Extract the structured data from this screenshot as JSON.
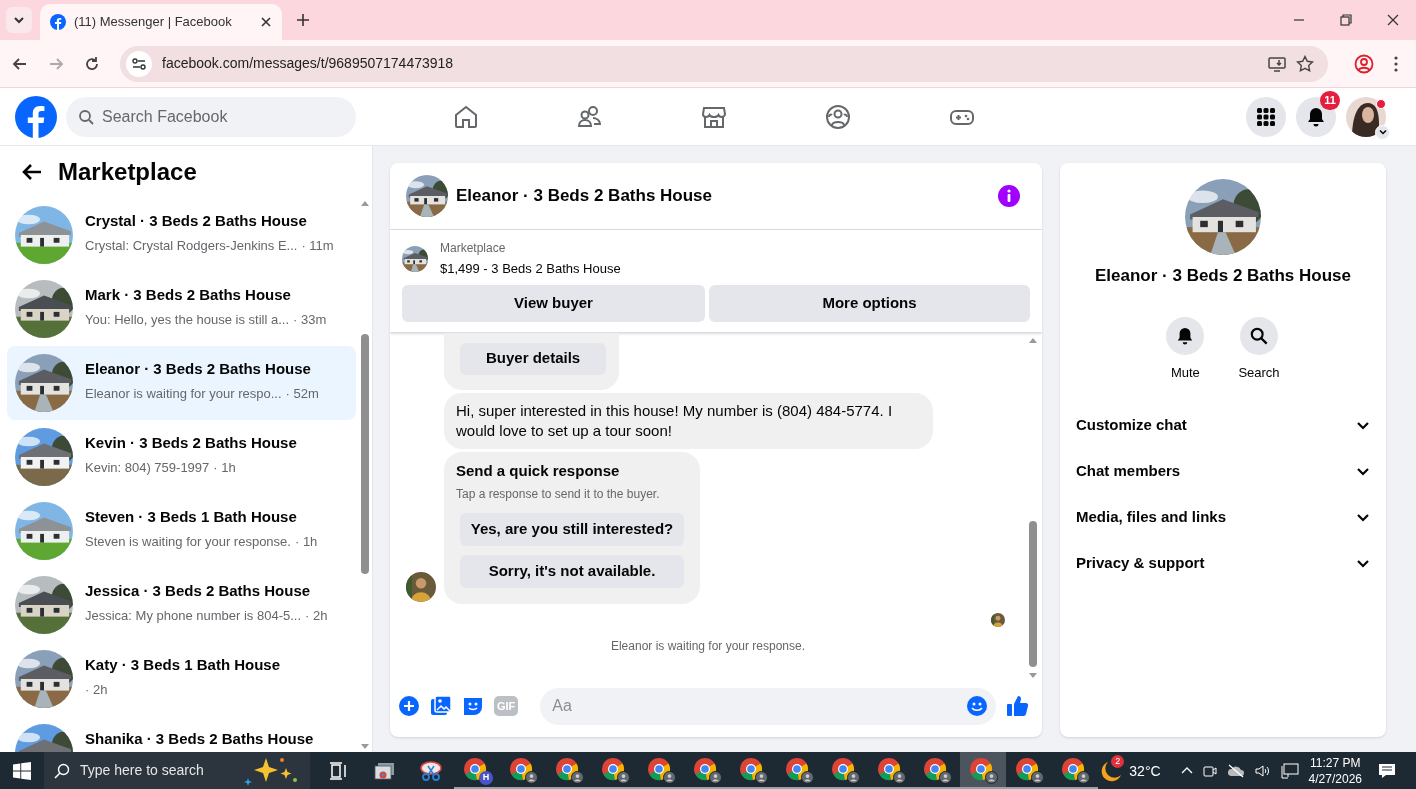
{
  "browser": {
    "tab_title": "(11) Messenger | Facebook",
    "url": "facebook.com/messages/t/9689507174473918"
  },
  "header": {
    "search_placeholder": "Search Facebook",
    "nav": [
      {
        "kind": "home"
      },
      {
        "kind": "friends"
      },
      {
        "kind": "marketplace"
      },
      {
        "kind": "groups"
      },
      {
        "kind": "gaming"
      }
    ],
    "notification_count": "11"
  },
  "sidebar": {
    "title": "Marketplace",
    "chats": [
      {
        "name": "Crystal · 3 Beds 2 Baths House",
        "preview": "Crystal: Crystal Rodgers-Jenkins E...",
        "time": "· 11m",
        "selected": false
      },
      {
        "name": "Mark · 3 Beds 2 Baths House",
        "preview": "You: Hello, yes the house is still a...",
        "time": "· 33m",
        "selected": false
      },
      {
        "name": "Eleanor · 3 Beds 2 Baths House",
        "preview": "Eleanor is waiting for your respo...",
        "time": "· 52m",
        "selected": true
      },
      {
        "name": "Kevin · 3 Beds 2 Baths House",
        "preview": "Kevin: 804) 759-1997",
        "time": "· 1h",
        "selected": false
      },
      {
        "name": "Steven · 3 Beds 1 Bath House",
        "preview": "Steven is waiting for your response.",
        "time": "· 1h",
        "selected": false
      },
      {
        "name": "Jessica · 3 Beds 2 Baths House",
        "preview": "Jessica: My phone number is 804-5...",
        "time": "· 2h",
        "selected": false
      },
      {
        "name": "Katy · 3 Beds 1 Bath House",
        "time": "· 2h",
        "selected": false
      },
      {
        "name": "Shanika · 3 Beds 2 Baths House",
        "selected": false
      }
    ]
  },
  "chat": {
    "title": "Eleanor · 3 Beds 2 Baths House",
    "listing": {
      "label": "Marketplace",
      "item": "$1,499 - 3 Beds 2 Baths House"
    },
    "actions": [
      "View buyer",
      "More options"
    ],
    "messages": [
      {
        "kind": "buttons",
        "buttons": [
          "Buyer details"
        ]
      },
      {
        "kind": "text",
        "text": "Hi, super interested in this house! My number is (804) 484-5774. I would love to set up a tour soon!"
      },
      {
        "kind": "quick_response",
        "title": "Send a quick response",
        "subtitle": "Tap a response to send it to the buyer.",
        "buttons": [
          "Yes, are you still interested?",
          "Sorry, it's not available."
        ]
      }
    ],
    "status": "Eleanor is waiting for your response.",
    "composer": {
      "gif": "GIF",
      "placeholder": "Aa"
    }
  },
  "details": {
    "name": "Eleanor · 3 Beds 2 Baths House",
    "actions": [
      {
        "kind": "mute",
        "label": "Mute"
      },
      {
        "kind": "search",
        "label": "Search"
      }
    ],
    "sections": [
      {
        "label": "Customize chat",
        "expanded": false
      },
      {
        "label": "Chat members",
        "expanded": false
      },
      {
        "label": "Media, files and links",
        "expanded": false
      },
      {
        "label": "Privacy & support",
        "expanded": false
      }
    ]
  },
  "taskbar": {
    "search_placeholder": "Type here to search",
    "apps": [
      {
        "kind": "task_view",
        "selected": false
      },
      {
        "kind": "screen",
        "selected": false
      },
      {
        "kind": "snip",
        "selected": false
      },
      {
        "kind": "chrome",
        "badge": "H",
        "selected": false
      },
      {
        "kind": "chrome",
        "selected": false
      },
      {
        "kind": "chrome",
        "selected": false
      },
      {
        "kind": "chrome",
        "selected": false
      },
      {
        "kind": "chrome",
        "selected": false
      },
      {
        "kind": "chrome",
        "selected": false
      },
      {
        "kind": "chrome",
        "selected": false
      },
      {
        "kind": "chrome",
        "selected": false
      },
      {
        "kind": "chrome",
        "selected": false
      },
      {
        "kind": "chrome",
        "selected": false
      },
      {
        "kind": "chrome",
        "selected": false
      },
      {
        "kind": "chrome",
        "selected": true
      },
      {
        "kind": "chrome",
        "selected": false
      },
      {
        "kind": "chrome",
        "selected": false
      }
    ],
    "weather": {
      "temperature": "32°C",
      "badge": "2"
    },
    "time": "11:27 PM",
    "date": "4/27/2026"
  }
}
